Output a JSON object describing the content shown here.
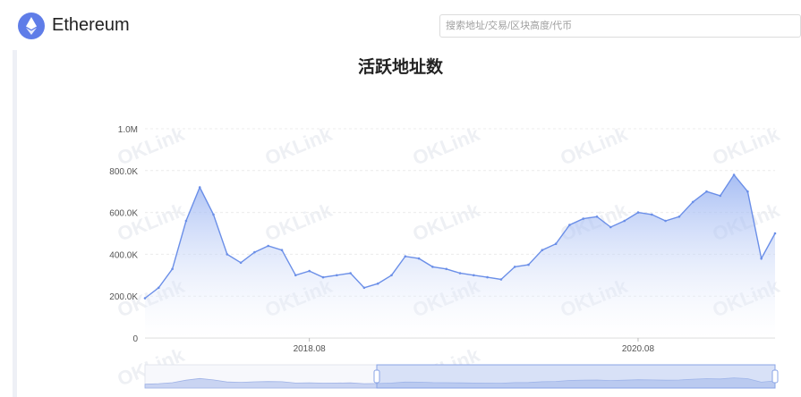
{
  "header": {
    "app_name": "Ethereum",
    "logo_icon": "ethereum-icon",
    "search_placeholder": "搜索地址/交易/区块高度/代币"
  },
  "watermark": "OKLink",
  "colors": {
    "line": "#6b8fe8",
    "area_top": "#8aa8f0",
    "area_bottom": "#ffffff",
    "accent": "#5f7de8"
  },
  "chart_data": {
    "type": "area",
    "title": "活跃地址数",
    "y_ticks": [
      "0",
      "200.0K",
      "400.0K",
      "600.0K",
      "800.0K",
      "1.0M"
    ],
    "x_ticks": [
      "2018.08",
      "2020.08"
    ],
    "ylim": [
      0,
      1000000
    ],
    "xlim": [
      "2017-08",
      "2021-06"
    ],
    "grid": true,
    "series": [
      {
        "x": [
          "2017-08",
          "2017-09",
          "2017-10",
          "2017-11",
          "2017-12",
          "2018-01",
          "2018-02",
          "2018-03",
          "2018-04",
          "2018-05",
          "2018-06",
          "2018-07",
          "2018-08",
          "2018-09",
          "2018-10",
          "2018-11",
          "2018-12",
          "2019-01",
          "2019-02",
          "2019-03",
          "2019-04",
          "2019-05",
          "2019-06",
          "2019-07",
          "2019-08",
          "2019-09",
          "2019-10",
          "2019-11",
          "2019-12",
          "2020-01",
          "2020-02",
          "2020-03",
          "2020-04",
          "2020-05",
          "2020-06",
          "2020-07",
          "2020-08",
          "2020-09",
          "2020-10",
          "2020-11",
          "2020-12",
          "2021-01",
          "2021-02",
          "2021-03",
          "2021-04",
          "2021-05",
          "2021-06"
        ],
        "values": [
          190000,
          240000,
          330000,
          560000,
          720000,
          590000,
          400000,
          360000,
          410000,
          440000,
          420000,
          300000,
          320000,
          290000,
          300000,
          310000,
          240000,
          260000,
          300000,
          390000,
          380000,
          340000,
          330000,
          310000,
          300000,
          290000,
          280000,
          340000,
          350000,
          420000,
          450000,
          540000,
          570000,
          580000,
          530000,
          560000,
          600000,
          590000,
          560000,
          580000,
          650000,
          700000,
          680000,
          780000,
          700000,
          380000,
          500000
        ]
      }
    ]
  },
  "zoom_slider": {
    "start_handle": "range-start-handle",
    "end_handle": "range-end-handle"
  }
}
